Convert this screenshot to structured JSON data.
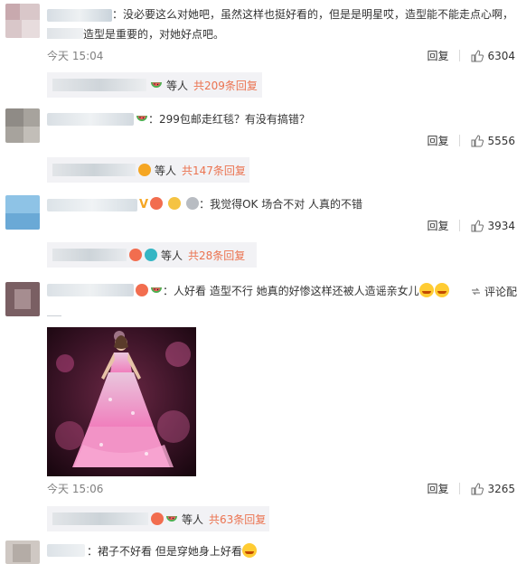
{
  "comments": [
    {
      "text_line1": "：没必要这么对她吧，虽然这样也挺好看的，但是是明星哎，造型能不能走点心啊，",
      "text_line2": "造型是重要的，对她好点吧。",
      "time": "今天 15:04",
      "reply_label": "回复",
      "likes": "6304",
      "sub": {
        "etc": "等人",
        "more": "共209条回复"
      }
    },
    {
      "text": "：299包邮走红毯？有没有搞错？",
      "reply_label": "回复",
      "likes": "5556",
      "sub": {
        "etc": "等人",
        "more": "共147条回复"
      }
    },
    {
      "text": "：我觉得OK 场合不对 人真的不错",
      "reply_label": "回复",
      "likes": "3934",
      "sub": {
        "etc": "等人",
        "more": "共28条回复"
      }
    },
    {
      "text": "：人好看 造型不行 她真的好惨这样还被人造谣亲女儿",
      "repost_label": "评论配",
      "time": "今天 15:06",
      "reply_label": "回复",
      "likes": "3265",
      "sub": {
        "etc": "等人",
        "more": "共63条回复"
      }
    },
    {
      "text": "：裙子不好看 但是穿她身上好看"
    }
  ],
  "colors": {
    "link": "#eb7350",
    "time": "#808080",
    "sub_bg": "#f2f2f5"
  },
  "icons": [
    "thumb-up-icon",
    "watermelon-badge-icon",
    "fan-badge-icon",
    "laugh-cry-emoji",
    "repost-icon"
  ]
}
